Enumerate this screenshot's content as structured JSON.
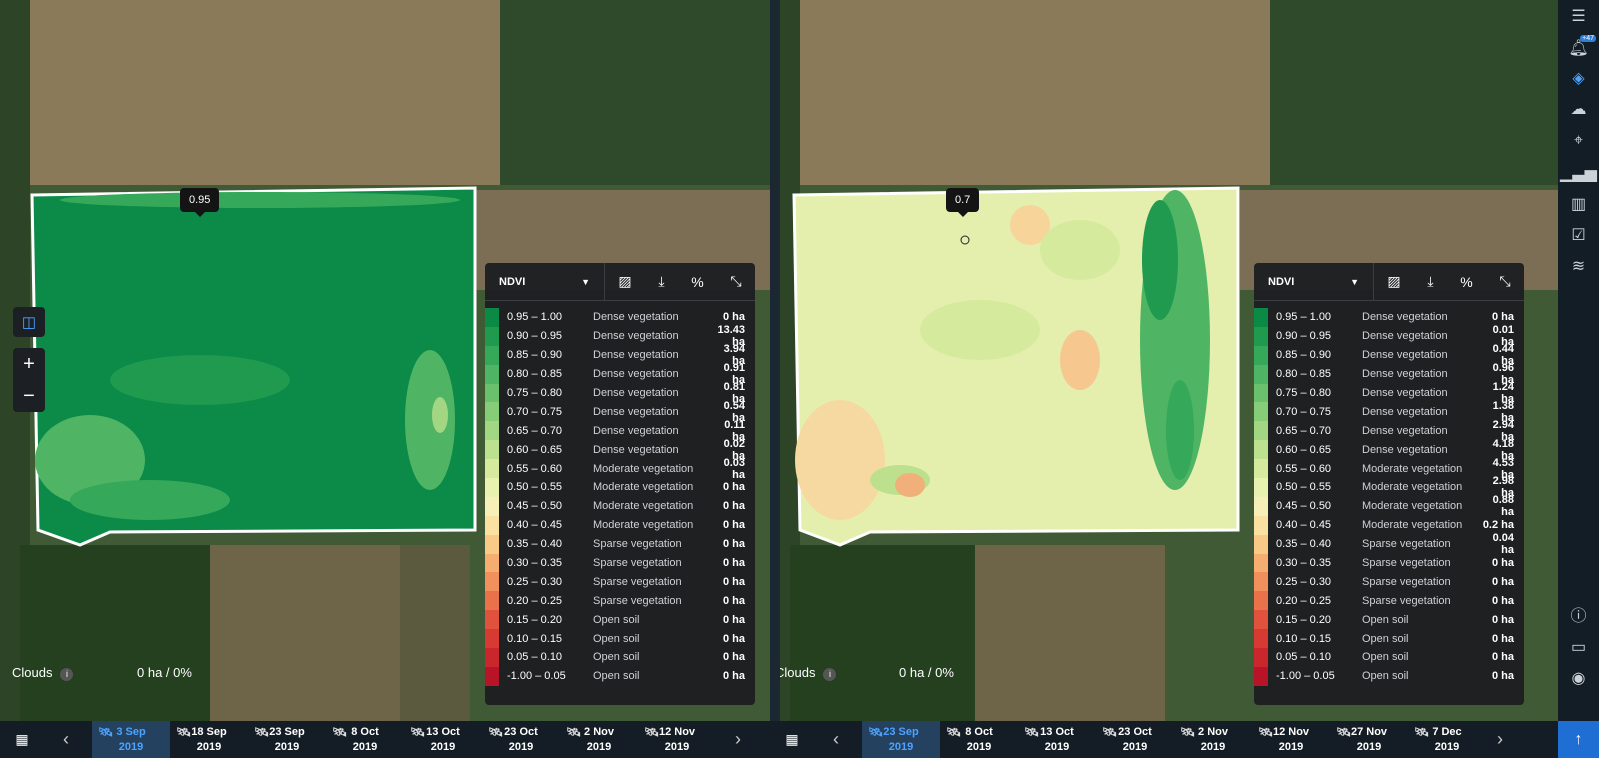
{
  "legend_classes": [
    {
      "range": "0.95 – 1.00",
      "class": "Dense vegetation",
      "color": "#0a8a45"
    },
    {
      "range": "0.90 – 0.95",
      "class": "Dense vegetation",
      "color": "#1f9a4f"
    },
    {
      "range": "0.85 – 0.90",
      "class": "Dense vegetation",
      "color": "#35a85a"
    },
    {
      "range": "0.80 – 0.85",
      "class": "Dense vegetation",
      "color": "#4fb564"
    },
    {
      "range": "0.75 – 0.80",
      "class": "Dense vegetation",
      "color": "#6ac06d"
    },
    {
      "range": "0.70 – 0.75",
      "class": "Dense vegetation",
      "color": "#87cc77"
    },
    {
      "range": "0.65 – 0.70",
      "class": "Dense vegetation",
      "color": "#a3d682"
    },
    {
      "range": "0.60 – 0.65",
      "class": "Dense vegetation",
      "color": "#bde08e"
    },
    {
      "range": "0.55 – 0.60",
      "class": "Moderate vegetation",
      "color": "#d5ea9c"
    },
    {
      "range": "0.50 – 0.55",
      "class": "Moderate vegetation",
      "color": "#e9f1b0"
    },
    {
      "range": "0.45 – 0.50",
      "class": "Moderate vegetation",
      "color": "#f6efb7"
    },
    {
      "range": "0.40 – 0.45",
      "class": "Moderate vegetation",
      "color": "#fae1a2"
    },
    {
      "range": "0.35 – 0.40",
      "class": "Sparse vegetation",
      "color": "#f9c987"
    },
    {
      "range": "0.30 – 0.35",
      "class": "Sparse vegetation",
      "color": "#f6ae70"
    },
    {
      "range": "0.25 – 0.30",
      "class": "Sparse vegetation",
      "color": "#f1905c"
    },
    {
      "range": "0.20 – 0.25",
      "class": "Sparse vegetation",
      "color": "#ea724b"
    },
    {
      "range": "0.15 – 0.20",
      "class": "Open soil",
      "color": "#e0523d"
    },
    {
      "range": "0.10 – 0.15",
      "class": "Open soil",
      "color": "#d63a33"
    },
    {
      "range": "0.05 – 0.10",
      "class": "Open soil",
      "color": "#c9262d"
    },
    {
      "range": "-1.00 – 0.05",
      "class": "Open soil",
      "color": "#b81428"
    }
  ],
  "left": {
    "tooltip": "0.95",
    "index_select": "NDVI",
    "areas": [
      "0 ha",
      "13.43 ha",
      "3.94 ha",
      "0.91 ha",
      "0.81 ha",
      "0.54 ha",
      "0.11 ha",
      "0.02 ha",
      "0.03 ha",
      "0 ha",
      "0 ha",
      "0 ha",
      "0 ha",
      "0 ha",
      "0 ha",
      "0 ha",
      "0 ha",
      "0 ha",
      "0 ha",
      "0 ha"
    ],
    "clouds_label": "Clouds",
    "clouds_value": "0 ha / 0%",
    "dates": [
      {
        "day": "3 Sep",
        "year": "2019",
        "active": true
      },
      {
        "day": "18 Sep",
        "year": "2019"
      },
      {
        "day": "23 Sep",
        "year": "2019"
      },
      {
        "day": "8 Oct",
        "year": "2019"
      },
      {
        "day": "13 Oct",
        "year": "2019"
      },
      {
        "day": "23 Oct",
        "year": "2019"
      },
      {
        "day": "2 Nov",
        "year": "2019"
      },
      {
        "day": "12 Nov",
        "year": "2019"
      }
    ]
  },
  "right": {
    "tooltip": "0.7",
    "index_select": "NDVI",
    "areas": [
      "0 ha",
      "0.01 ha",
      "0.44 ha",
      "0.96 ha",
      "1.24 ha",
      "1.38 ha",
      "2.94 ha",
      "4.18 ha",
      "4.53 ha",
      "2.98 ha",
      "0.88 ha",
      "0.2 ha",
      "0.04 ha",
      "0 ha",
      "0 ha",
      "0 ha",
      "0 ha",
      "0 ha",
      "0 ha",
      "0 ha"
    ],
    "clouds_label": "Clouds",
    "clouds_value": "0 ha / 0%",
    "dates": [
      {
        "day": "23 Sep",
        "year": "2019",
        "active": true
      },
      {
        "day": "8 Oct",
        "year": "2019"
      },
      {
        "day": "13 Oct",
        "year": "2019"
      },
      {
        "day": "23 Oct",
        "year": "2019"
      },
      {
        "day": "2 Nov",
        "year": "2019"
      },
      {
        "day": "12 Nov",
        "year": "2019"
      },
      {
        "day": "27 Nov",
        "year": "2019"
      },
      {
        "day": "7 Dec",
        "year": "2019"
      }
    ]
  },
  "sidebar": {
    "notification_badge": "+47",
    "icons": [
      "menu-icon",
      "bell-icon",
      "layers-icon",
      "cloud-icon",
      "location-pin-icon",
      "signal-chart-icon",
      "dashboard-icon",
      "calendar-check-icon",
      "database-icon",
      "info-icon",
      "monitor-icon",
      "account-icon",
      "upload-arrow-icon"
    ]
  },
  "colors": {
    "accent": "#4da3ff",
    "panel": "#1c1e22",
    "field_outline": "#ffffff"
  }
}
